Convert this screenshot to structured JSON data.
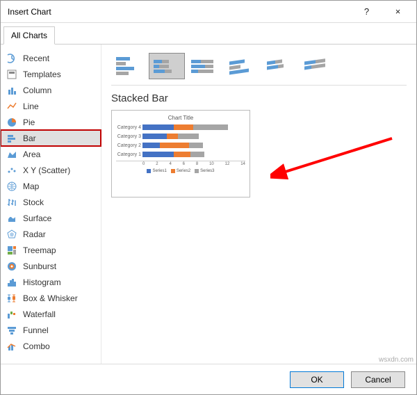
{
  "titlebar": {
    "title": "Insert Chart",
    "help": "?",
    "close": "×"
  },
  "tab": {
    "label": "All Charts"
  },
  "sidebar": {
    "items": [
      {
        "label": "Recent"
      },
      {
        "label": "Templates"
      },
      {
        "label": "Column"
      },
      {
        "label": "Line"
      },
      {
        "label": "Pie"
      },
      {
        "label": "Bar"
      },
      {
        "label": "Area"
      },
      {
        "label": "X Y (Scatter)"
      },
      {
        "label": "Map"
      },
      {
        "label": "Stock"
      },
      {
        "label": "Surface"
      },
      {
        "label": "Radar"
      },
      {
        "label": "Treemap"
      },
      {
        "label": "Sunburst"
      },
      {
        "label": "Histogram"
      },
      {
        "label": "Box & Whisker"
      },
      {
        "label": "Waterfall"
      },
      {
        "label": "Funnel"
      },
      {
        "label": "Combo"
      }
    ]
  },
  "section": {
    "title": "Stacked Bar"
  },
  "preview": {
    "title": "Chart Title"
  },
  "axis_ticks": [
    "0",
    "2",
    "4",
    "6",
    "8",
    "10",
    "12",
    "14"
  ],
  "legend": {
    "s1": "Series1",
    "s2": "Series2",
    "s3": "Series3"
  },
  "footer": {
    "ok": "OK",
    "cancel": "Cancel"
  },
  "watermark": "wsxdn.com",
  "chart_data": {
    "type": "bar",
    "orientation": "horizontal",
    "stacked": true,
    "title": "Chart Title",
    "xlabel": "",
    "ylabel": "",
    "xlim": [
      0,
      14
    ],
    "categories": [
      "Category 4",
      "Category 3",
      "Category 2",
      "Category 1"
    ],
    "series": [
      {
        "name": "Series1",
        "color": "#4472C4",
        "values": [
          4.5,
          3.5,
          2.5,
          4.5
        ]
      },
      {
        "name": "Series2",
        "color": "#ED7D31",
        "values": [
          2.8,
          1.6,
          4.2,
          2.4
        ]
      },
      {
        "name": "Series3",
        "color": "#A5A5A5",
        "values": [
          5.0,
          3.0,
          2.0,
          2.0
        ]
      }
    ],
    "legend_position": "bottom",
    "grid": true
  }
}
